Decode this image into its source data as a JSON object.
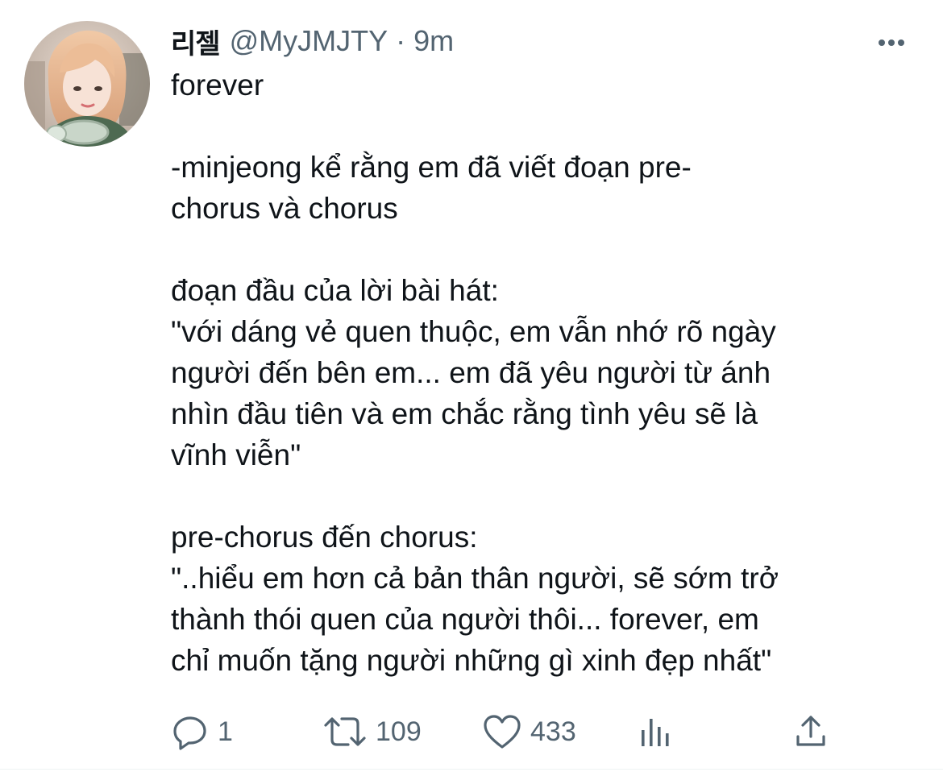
{
  "tweet": {
    "author": {
      "display_name": "리젤",
      "handle": "@MyJMJTY",
      "separator": "·",
      "time": "9m",
      "avatar_icon": "profile-photo"
    },
    "more_icon": "more-horizontal-icon",
    "paragraphs": [
      "forever",
      "-minjeong kể rằng em đã viết đoạn pre-\nchorus và chorus",
      "đoạn đầu của lời bài hát:\n\"với dáng vẻ quen thuộc, em vẫn nhớ rõ ngày\nngười đến bên em... em đã yêu người từ ánh\nnhìn đầu tiên và em chắc rằng tình yêu sẽ là\nvĩnh viễn\"",
      "pre-chorus đến chorus:\n\"..hiểu em hơn cả bản thân người, sẽ sớm trở\nthành thói quen của người thôi... forever, em\nchỉ muốn tặng người những gì xinh đẹp nhất\""
    ],
    "actions": {
      "reply_count": "1",
      "retweet_count": "109",
      "like_count": "433"
    },
    "colors": {
      "text": "#0f1419",
      "secondary": "#536471"
    }
  }
}
